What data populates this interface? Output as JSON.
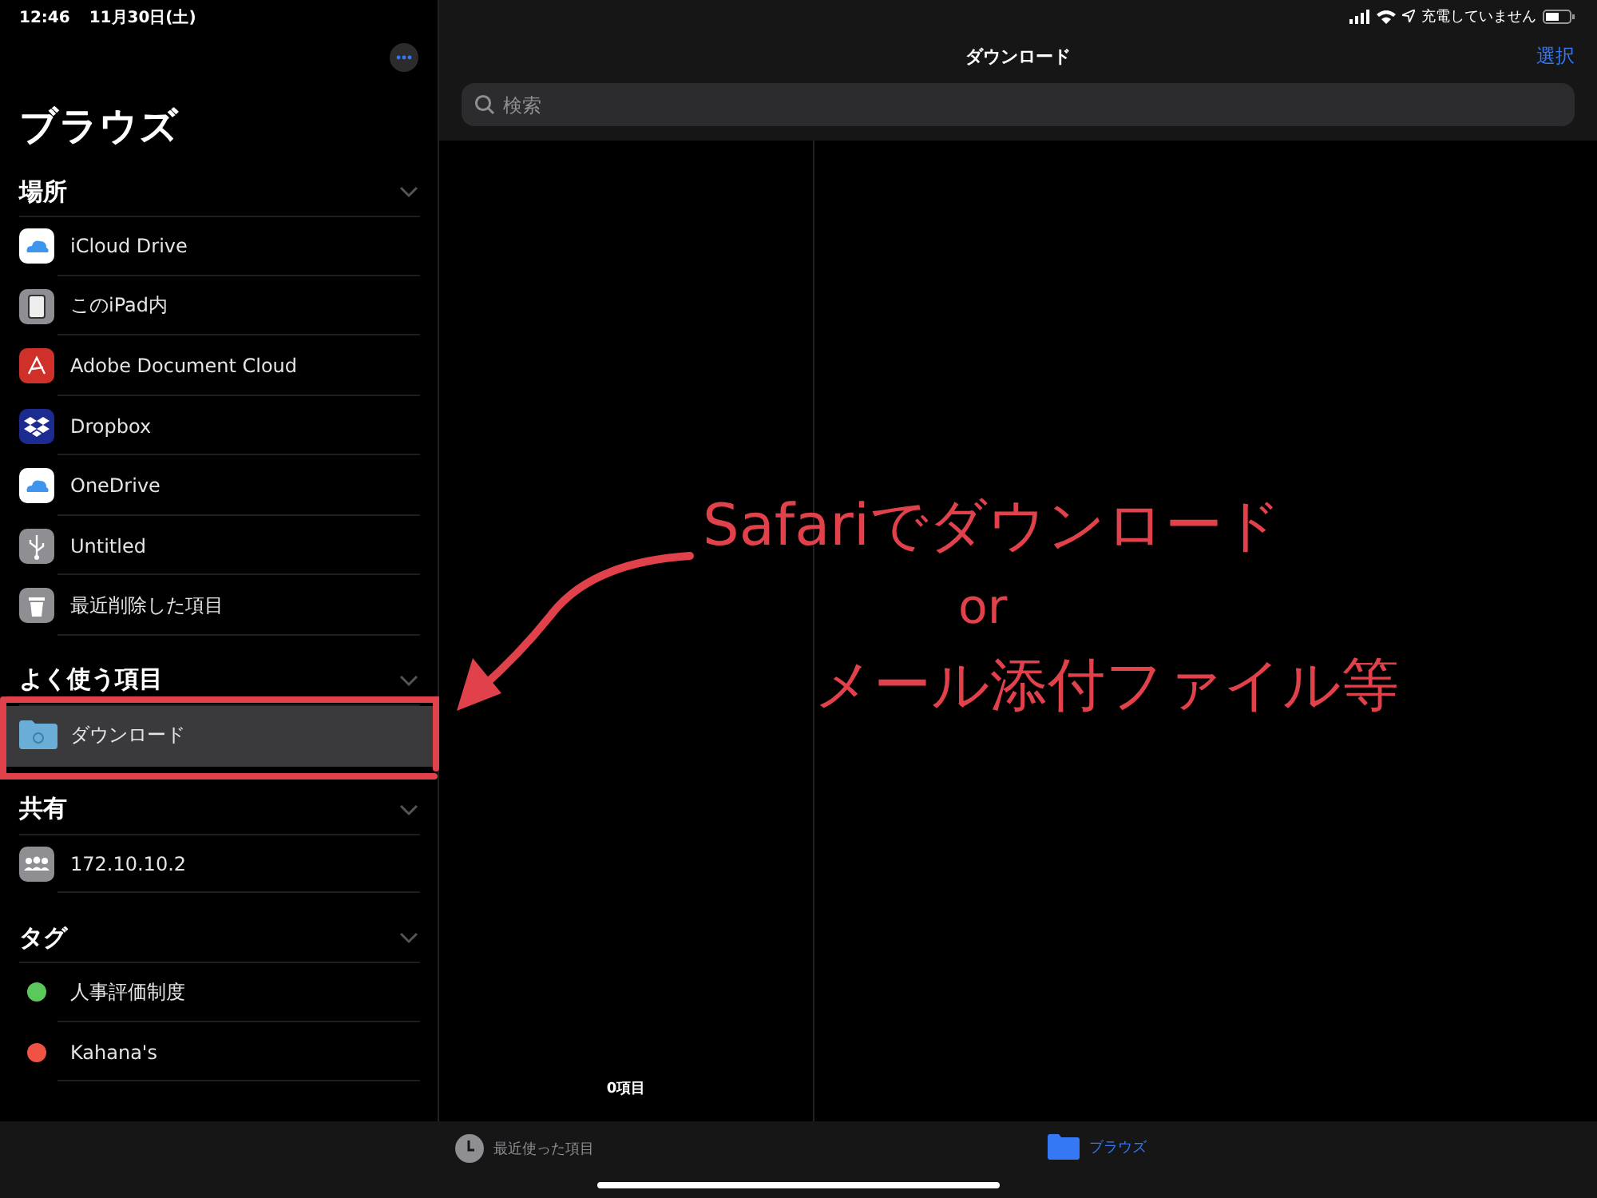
{
  "status_bar": {
    "time": "12:46",
    "date": "11月30日(土)",
    "charging": "充電していません"
  },
  "sidebar": {
    "title": "ブラウズ",
    "sections": [
      {
        "title": "場所",
        "expanded": true,
        "items": [
          {
            "label": "iCloud Drive",
            "selected": false
          },
          {
            "label": "このiPad内",
            "selected": false
          },
          {
            "label": "Adobe Document Cloud",
            "selected": false
          },
          {
            "label": "Dropbox",
            "selected": false
          },
          {
            "label": "OneDrive",
            "selected": false
          },
          {
            "label": "Untitled",
            "selected": false
          },
          {
            "label": "最近削除した項目",
            "selected": false
          }
        ]
      },
      {
        "title": "よく使う項目",
        "expanded": true,
        "items": [
          {
            "label": "ダウンロード",
            "selected": true
          }
        ]
      },
      {
        "title": "共有",
        "expanded": true,
        "items": [
          {
            "label": "172.10.10.2",
            "selected": false
          }
        ]
      },
      {
        "title": "タグ",
        "expanded": true,
        "items": [
          {
            "label": "人事評価制度",
            "selected": false,
            "color": "#5ac85a"
          },
          {
            "label": "Kahana's",
            "selected": false,
            "color": "#ef5343"
          }
        ]
      }
    ]
  },
  "main": {
    "title": "ダウンロード",
    "select_button": "選択",
    "search_placeholder": "検索",
    "item_count": "0項目"
  },
  "tab_bar": [
    {
      "label": "最近使った項目",
      "selected": false
    },
    {
      "label": "ブラウズ",
      "selected": true
    }
  ],
  "annotation": {
    "lines": [
      "Safariでダウンロード",
      "or",
      "メール添付ファイル等"
    ]
  }
}
